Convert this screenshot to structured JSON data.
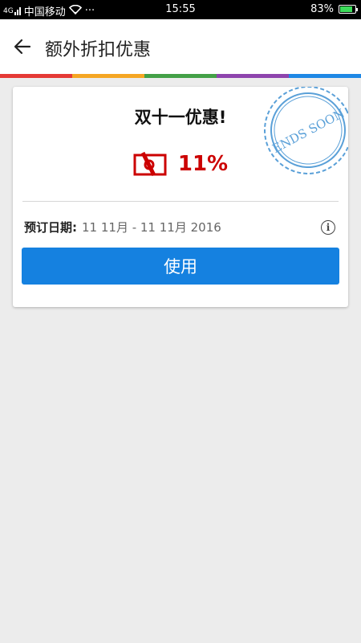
{
  "status_bar": {
    "carrier": "中国移动",
    "signal_label": "4G",
    "dots": "···",
    "time": "15:55",
    "battery_text": "83%",
    "battery_level": 0.83
  },
  "header": {
    "title": "额外折扣优惠",
    "back_icon": "arrow-left-icon"
  },
  "accent_stripe": [
    "#e53935",
    "#f5a623",
    "#43a047",
    "#8e44ad",
    "#1e88e5"
  ],
  "offer": {
    "title": "双十一优惠!",
    "discount": "11%",
    "discount_color": "#cc0000",
    "stamp_text": "ENDS SOON",
    "stamp_color": "#5aa0d8",
    "date_label": "预订日期:",
    "date_value": "11 11月 - 11 11月 2016",
    "info_glyph": "i",
    "use_button_label": "使用",
    "use_button_color": "#1581e0"
  }
}
